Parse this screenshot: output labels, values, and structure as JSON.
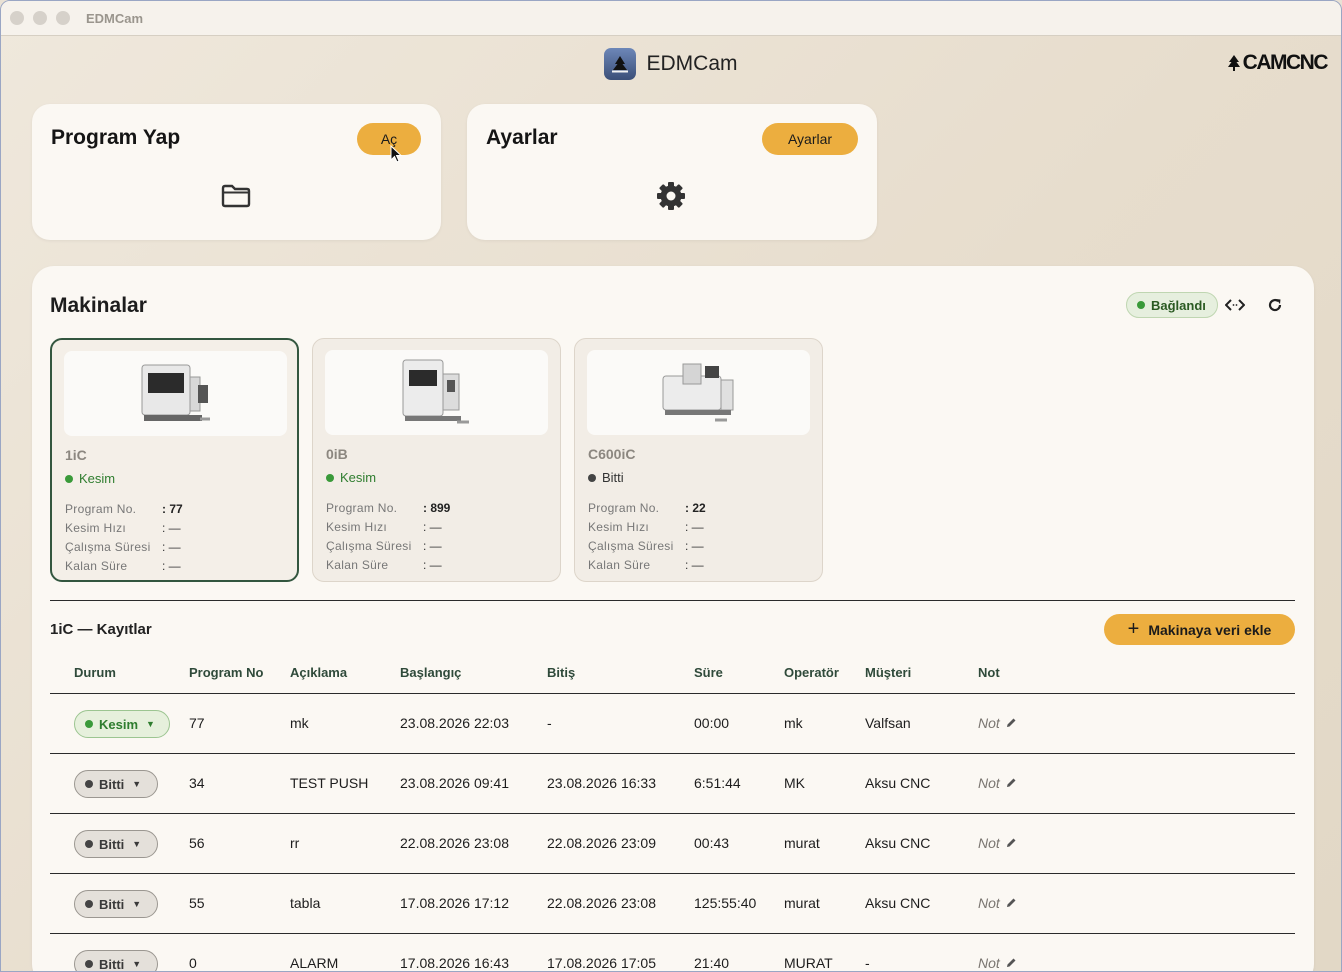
{
  "window": {
    "title": "EDMCam"
  },
  "header": {
    "app_title": "EDMCam",
    "brand": "CAMCNC"
  },
  "program_card": {
    "title": "Program Yap",
    "button": "Aç",
    "icon": "folder-icon"
  },
  "settings_card": {
    "title": "Ayarlar",
    "button": "Ayarlar",
    "icon": "gear-icon"
  },
  "machines": {
    "title": "Makinalar",
    "connection_status": "Bağlandı",
    "cards": [
      {
        "name": "1iC",
        "status": "Kesim",
        "rows": [
          {
            "label": "Program No.",
            "value": ": 77"
          },
          {
            "label": "Kesim Hızı",
            "value": ": —"
          },
          {
            "label": "Çalışma Süresi",
            "value": ": —"
          },
          {
            "label": "Kalan Süre",
            "value": ": —"
          }
        ]
      },
      {
        "name": "0iB",
        "status": "Kesim",
        "rows": [
          {
            "label": "Program No.",
            "value": ": 899"
          },
          {
            "label": "Kesim Hızı",
            "value": ": —"
          },
          {
            "label": "Çalışma Süresi",
            "value": ": —"
          },
          {
            "label": "Kalan Süre",
            "value": ": —"
          }
        ]
      },
      {
        "name": "C600iC",
        "status": "Bitti",
        "rows": [
          {
            "label": "Program No.",
            "value": ": 22"
          },
          {
            "label": "Kesim Hızı",
            "value": ": —"
          },
          {
            "label": "Çalışma Süresi",
            "value": ": —"
          },
          {
            "label": "Kalan Süre",
            "value": ": —"
          }
        ]
      }
    ]
  },
  "records": {
    "title": "1iC — Kayıtlar",
    "add_button": "Makinaya veri ekle",
    "columns": [
      "Durum",
      "Program No",
      "Açıklama",
      "Başlangıç",
      "Bitiş",
      "Süre",
      "Operatör",
      "Müşteri",
      "Not"
    ],
    "note_label": "Not",
    "rows": [
      {
        "status": "Kesim",
        "program_no": "77",
        "desc": "mk",
        "start": "23.08.2026  22:03",
        "end": "-",
        "duration": "00:00",
        "operator": "mk",
        "customer": "Valfsan"
      },
      {
        "status": "Bitti",
        "program_no": "34",
        "desc": "TEST PUSH",
        "start": "23.08.2026  09:41",
        "end": "23.08.2026  16:33",
        "duration": "6:51:44",
        "operator": "MK",
        "customer": "Aksu CNC"
      },
      {
        "status": "Bitti",
        "program_no": "56",
        "desc": "rr",
        "start": "22.08.2026  23:08",
        "end": "22.08.2026  23:09",
        "duration": "00:43",
        "operator": "murat",
        "customer": "Aksu CNC"
      },
      {
        "status": "Bitti",
        "program_no": "55",
        "desc": "tabla",
        "start": "17.08.2026  17:12",
        "end": "22.08.2026  23:08",
        "duration": "125:55:40",
        "operator": "murat",
        "customer": "Aksu CNC"
      },
      {
        "status": "Bitti",
        "program_no": "0",
        "desc": "ALARM",
        "start": "17.08.2026  16:43",
        "end": "17.08.2026  17:05",
        "duration": "21:40",
        "operator": "MURAT",
        "customer": "-"
      }
    ]
  },
  "colors": {
    "accent": "#ecae3f",
    "selected_border": "#33563f",
    "kesim_green": "#2f7d2f"
  }
}
